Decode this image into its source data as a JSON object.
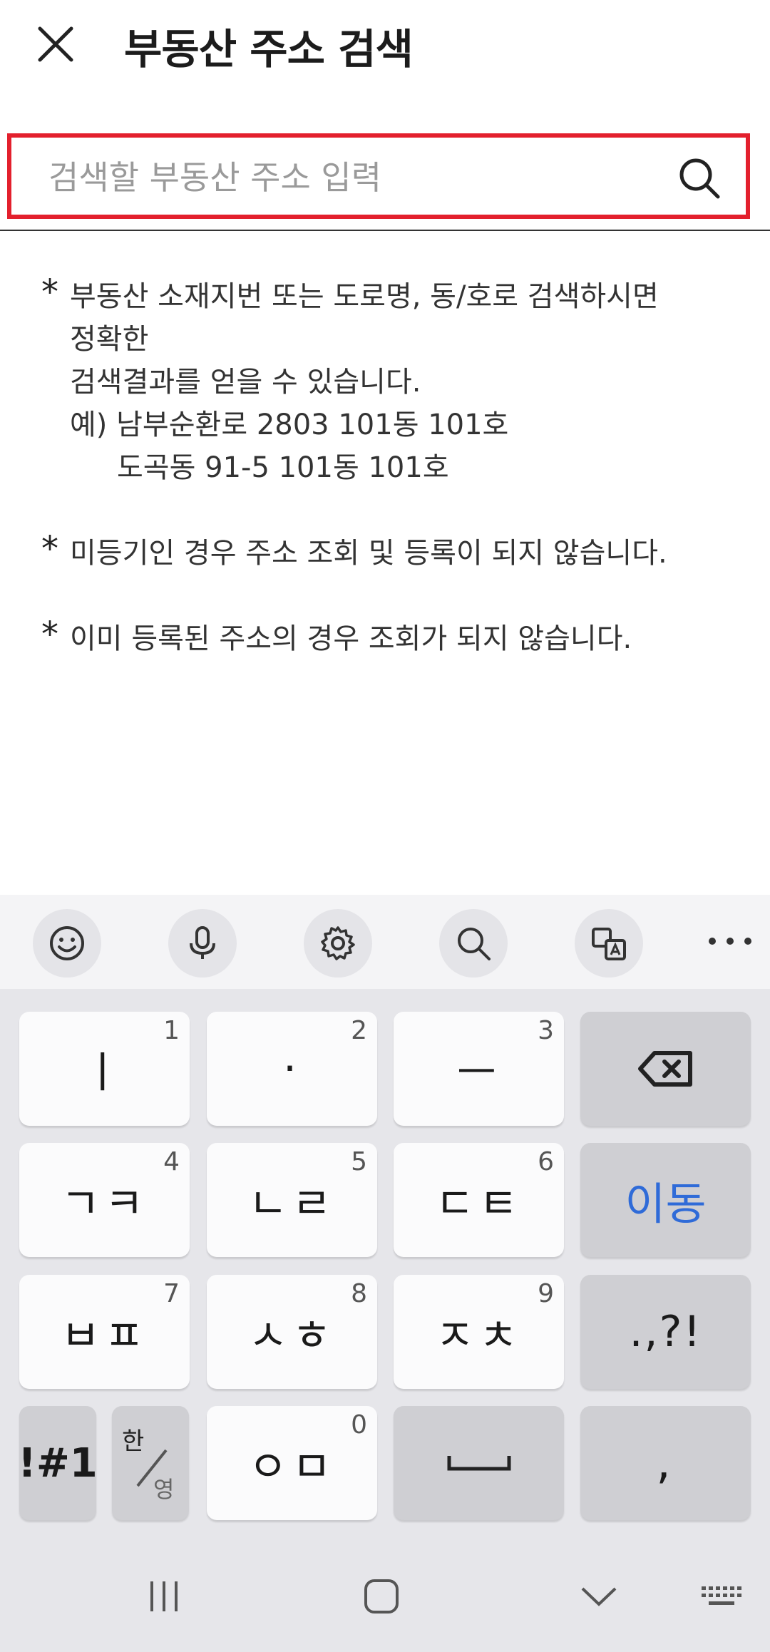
{
  "header": {
    "title": "부동산 주소 검색"
  },
  "search": {
    "placeholder": "검색할 부동산 주소 입력",
    "value": ""
  },
  "notes": [
    {
      "lines": [
        "부동산 소재지번 또는 도로명, 동/호로 검색하시면",
        "정확한",
        "검색결과를 얻을 수 있습니다.",
        "예) 남부순환로 2803 101동 101호",
        "도곡동 91-5 101동 101호"
      ]
    },
    {
      "lines": [
        "미등기인 경우 주소 조회 및 등록이 되지 않습니다."
      ]
    },
    {
      "lines": [
        "이미 등록된 주소의 경우 조회가 되지 않습니다."
      ]
    }
  ],
  "keyboard": {
    "toolbar": [
      "emoji-icon",
      "microphone-icon",
      "gear-icon",
      "search-icon",
      "translate-icon",
      "more-icon"
    ],
    "rows": [
      [
        {
          "label": "ㅣ",
          "num": "1"
        },
        {
          "label": "·",
          "num": "2"
        },
        {
          "label": "ㅡ",
          "num": "3"
        },
        {
          "label": "backspace-icon",
          "num": ""
        }
      ],
      [
        {
          "label": "ㄱㅋ",
          "num": "4"
        },
        {
          "label": "ㄴㄹ",
          "num": "5"
        },
        {
          "label": "ㄷㅌ",
          "num": "6"
        },
        {
          "label": "이동",
          "num": ""
        }
      ],
      [
        {
          "label": "ㅂㅍ",
          "num": "7"
        },
        {
          "label": "ㅅㅎ",
          "num": "8"
        },
        {
          "label": "ㅈㅊ",
          "num": "9"
        },
        {
          "label": ".,?!",
          "num": ""
        }
      ],
      [
        {
          "label": "!#1",
          "num": ""
        },
        {
          "label": "한/영",
          "num": ""
        },
        {
          "label": "ㅇㅁ",
          "num": "0"
        },
        {
          "label": "space-icon",
          "num": ""
        },
        {
          "label": ",",
          "num": ""
        }
      ]
    ],
    "lang_top": "한",
    "lang_bottom": "영"
  },
  "colors": {
    "accent": "#e3202d",
    "key_blue": "#2f6bd8"
  }
}
